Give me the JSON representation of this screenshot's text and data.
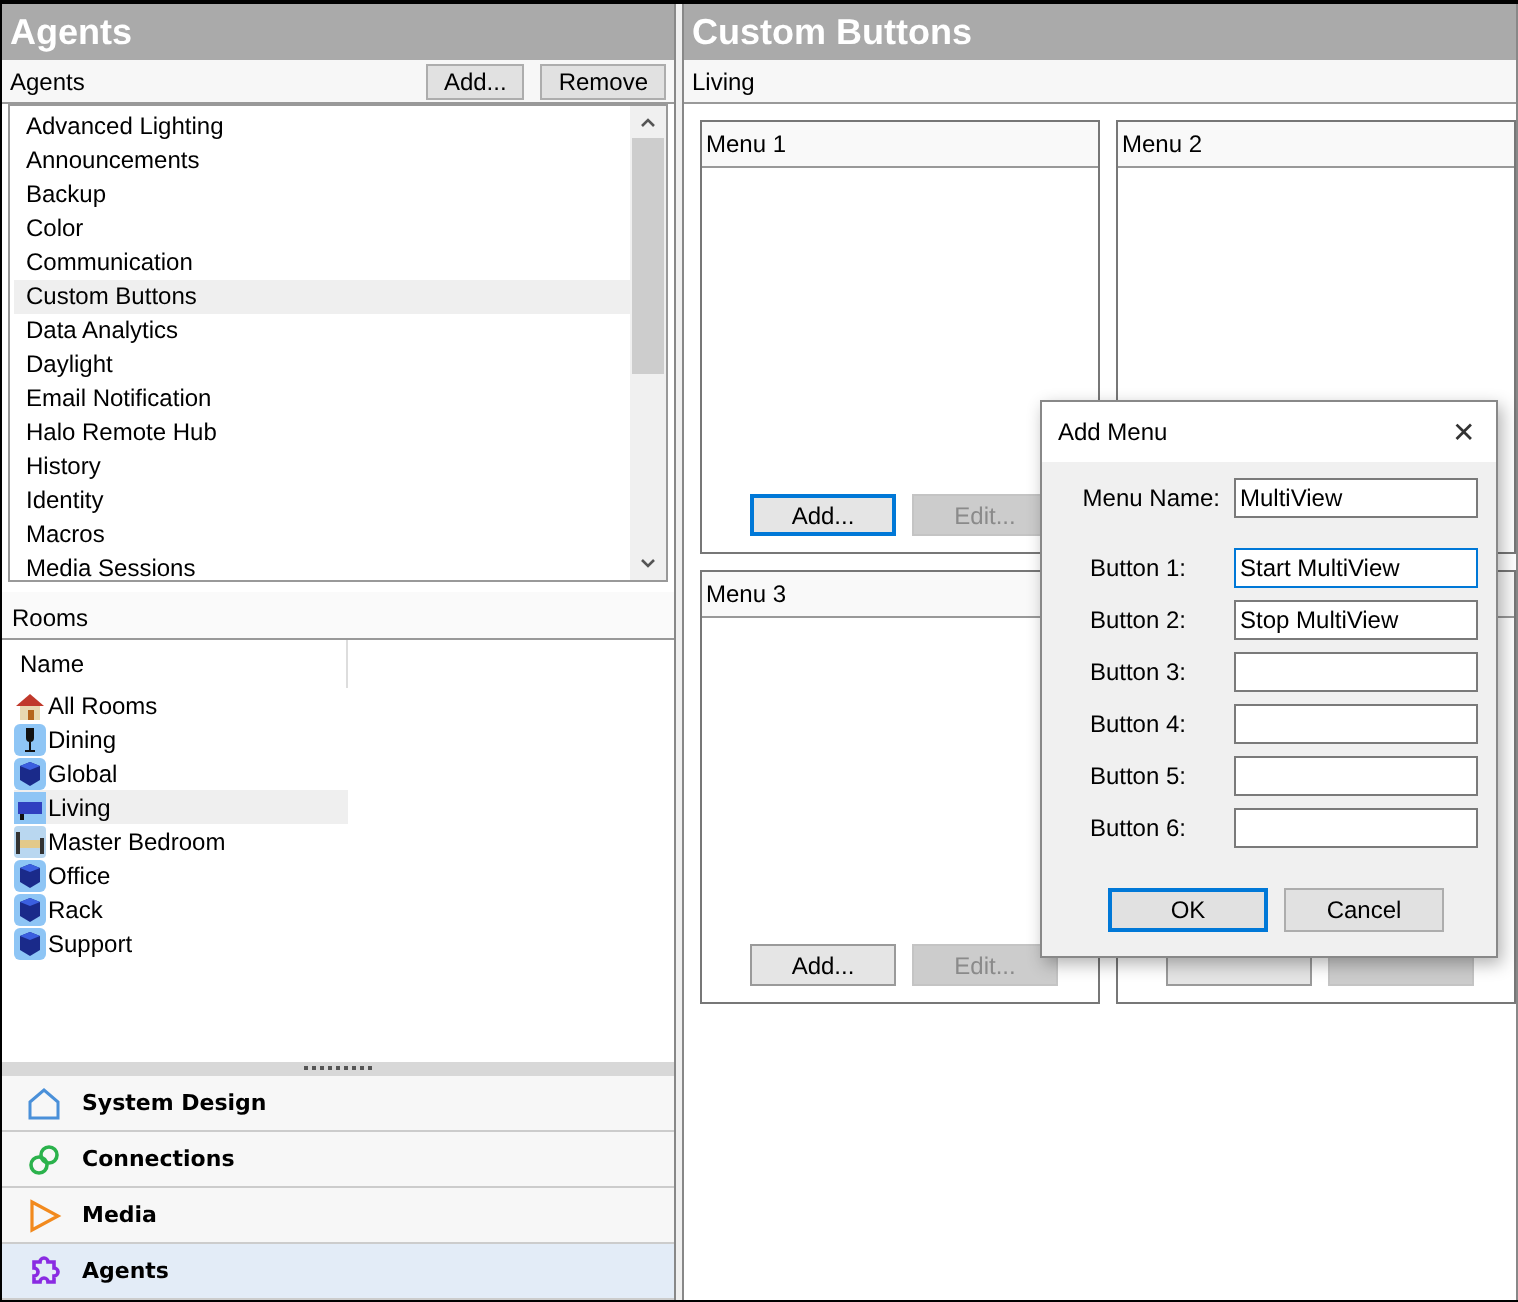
{
  "left_panel": {
    "title": "Agents",
    "agents": {
      "label": "Agents",
      "buttons": [
        "Add...",
        "Remove"
      ],
      "items": [
        {
          "label": "Advanced Lighting",
          "selected": false
        },
        {
          "label": "Announcements",
          "selected": false
        },
        {
          "label": "Backup",
          "selected": false
        },
        {
          "label": "Color",
          "selected": false
        },
        {
          "label": "Communication",
          "selected": false
        },
        {
          "label": "Custom Buttons",
          "selected": true
        },
        {
          "label": "Data Analytics",
          "selected": false
        },
        {
          "label": "Daylight",
          "selected": false
        },
        {
          "label": "Email Notification",
          "selected": false
        },
        {
          "label": "Halo Remote Hub",
          "selected": false
        },
        {
          "label": "History",
          "selected": false
        },
        {
          "label": "Identity",
          "selected": false
        },
        {
          "label": "Macros",
          "selected": false
        },
        {
          "label": "Media Sessions",
          "selected": false
        }
      ]
    },
    "rooms": {
      "label": "Rooms",
      "column": "Name",
      "items": [
        {
          "label": "All Rooms",
          "kind": "house",
          "selected": false
        },
        {
          "label": "Dining",
          "kind": "dining",
          "selected": false
        },
        {
          "label": "Global",
          "kind": "cube",
          "selected": false
        },
        {
          "label": "Living",
          "kind": "living",
          "selected": true
        },
        {
          "label": "Master Bedroom",
          "kind": "bed",
          "selected": false
        },
        {
          "label": "Office",
          "kind": "cube",
          "selected": false
        },
        {
          "label": "Rack",
          "kind": "cube",
          "selected": false
        },
        {
          "label": "Support",
          "kind": "cube",
          "selected": false
        }
      ]
    },
    "nav": [
      {
        "label": "System Design",
        "kind": "house",
        "selected": false
      },
      {
        "label": "Connections",
        "kind": "link",
        "selected": false
      },
      {
        "label": "Media",
        "kind": "play",
        "selected": false
      },
      {
        "label": "Agents",
        "kind": "puzzle",
        "selected": true
      }
    ]
  },
  "main": {
    "title": "Custom Buttons",
    "room": "Living",
    "menus": [
      {
        "title": "Menu 1",
        "buttons": [
          {
            "label": "Add...",
            "disabled": false,
            "focused": true
          },
          {
            "label": "Edit...",
            "disabled": true,
            "focused": false
          }
        ]
      },
      {
        "title": "Menu 2"
      },
      {
        "title": "Menu 3",
        "buttons": [
          {
            "label": "Add...",
            "disabled": false,
            "focused": false
          },
          {
            "label": "Edit...",
            "disabled": true,
            "focused": false
          }
        ]
      },
      {
        "buttons": [
          {
            "disabled": false,
            "focused": false
          },
          {
            "disabled": true,
            "focused": false
          }
        ]
      }
    ]
  },
  "dialog": {
    "title": "Add Menu",
    "close": "✕",
    "fields": [
      {
        "label": "Menu Name:",
        "value": "MultiView",
        "focused": false
      },
      {
        "label": "Button 1:",
        "value": "Start MultiView",
        "focused": true
      },
      {
        "label": "Button 2:",
        "value": "Stop MultiView",
        "focused": false
      },
      {
        "label": "Button 3:",
        "focused": false
      },
      {
        "label": "Button 4:",
        "focused": false
      },
      {
        "label": "Button 5:",
        "focused": false
      },
      {
        "label": "Button 6:",
        "focused": false
      }
    ],
    "buttons": [
      {
        "label": "OK",
        "focused": true
      },
      {
        "label": "Cancel",
        "focused": false
      }
    ]
  }
}
